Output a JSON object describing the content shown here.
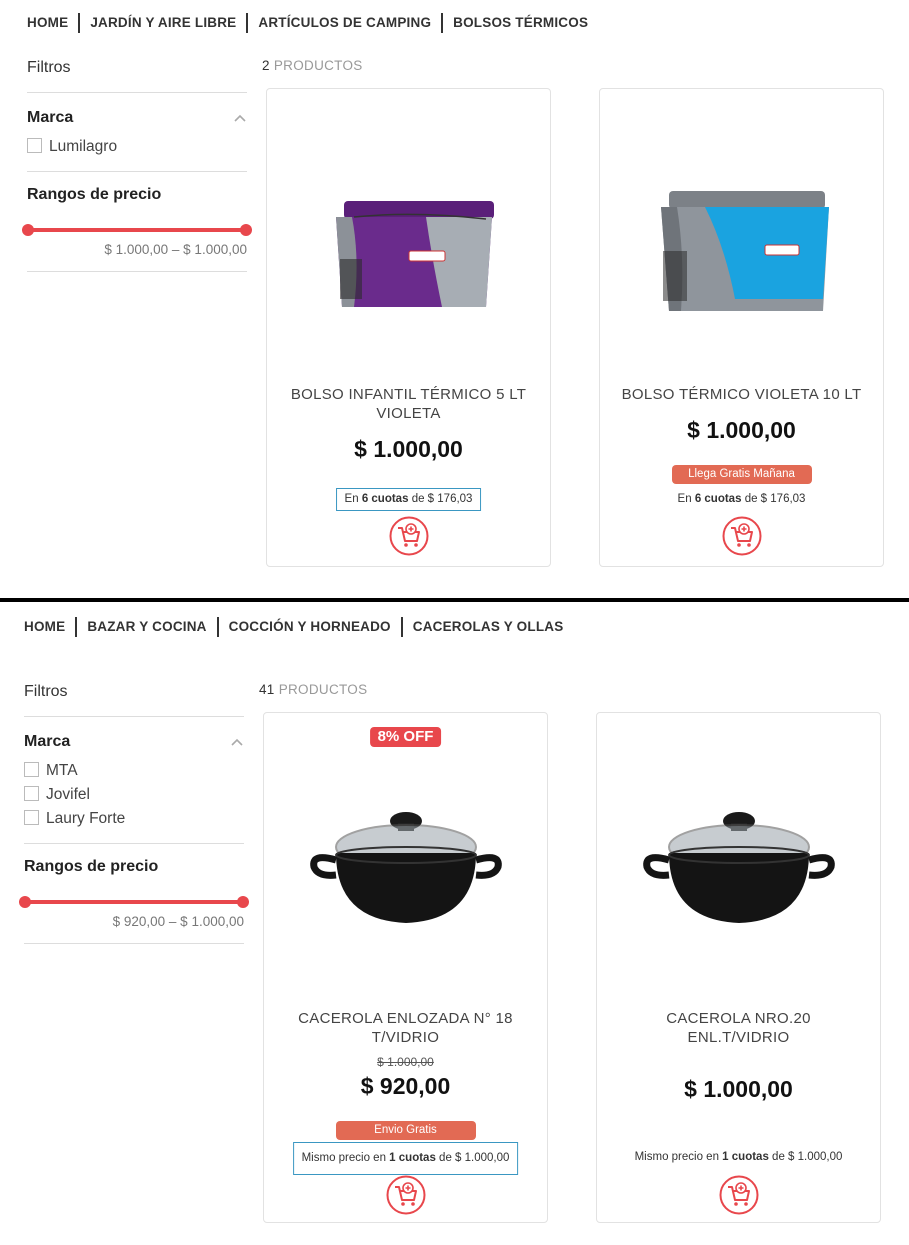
{
  "panel1": {
    "breadcrumb": [
      "HOME",
      "JARDÍN Y AIRE LIBRE",
      "ARTÍCULOS DE CAMPING",
      "BOLSOS TÉRMICOS"
    ],
    "filters_label": "Filtros",
    "brand_title": "Marca",
    "brands": [
      "Lumilagro"
    ],
    "price_title": "Rangos de precio",
    "price_range": "$ 1.000,00 – $ 1.000,00",
    "count_num": "2",
    "count_label": "PRODUCTOS",
    "products": [
      {
        "title_line1": "BOLSO INFANTIL TÉRMICO 5 LT",
        "title_line2": "VIOLETA",
        "price": "$ 1.000,00",
        "cuotas_pre": "En",
        "cuotas_bold": "6 cuotas",
        "cuotas_post": "de $ 176,03",
        "image": "purple-cooler-bag",
        "bag_color": "#6a2b8c"
      },
      {
        "title_line1": "BOLSO TÉRMICO VIOLETA 10 LT",
        "title_line2": "",
        "price": "$ 1.000,00",
        "badge": "Llega Gratis Mañana",
        "cuotas_pre": "En",
        "cuotas_bold": "6 cuotas",
        "cuotas_post": "de $ 176,03",
        "image": "blue-cooler-bag",
        "bag_color": "#1aa3e0"
      }
    ]
  },
  "panel2": {
    "breadcrumb": [
      "HOME",
      "BAZAR Y COCINA",
      "COCCIÓN Y HORNEADO",
      "CACEROLAS Y OLLAS"
    ],
    "filters_label": "Filtros",
    "brand_title": "Marca",
    "brands": [
      "MTA",
      "Jovifel",
      "Laury Forte"
    ],
    "price_title": "Rangos de precio",
    "price_range": "$ 920,00 – $ 1.000,00",
    "count_num": "41",
    "count_label": "PRODUCTOS",
    "products": [
      {
        "discount": "8% OFF",
        "title_line1": "CACEROLA ENLOZADA N° 18",
        "title_line2": "T/VIDRIO",
        "old_price": "$ 1.000,00",
        "price": "$ 920,00",
        "badge": "Envio Gratis",
        "cuotas_pre": "Mismo precio en",
        "cuotas_bold": "1 cuotas",
        "cuotas_post": "de $ 1.000,00",
        "image": "black-enamel-pot"
      },
      {
        "title_line1": "CACEROLA NRO.20",
        "title_line2": "ENL.T/VIDRIO",
        "price": "$ 1.000,00",
        "cuotas_pre": "Mismo precio en",
        "cuotas_bold": "1 cuotas",
        "cuotas_post": "de $ 1.000,00",
        "image": "black-enamel-pot"
      }
    ]
  },
  "colors": {
    "accent": "#e8474c",
    "badge": "#e26a54",
    "cuotas_border": "#3a97c2"
  },
  "icons": [
    "chevron-up-icon",
    "add-to-cart-icon"
  ]
}
